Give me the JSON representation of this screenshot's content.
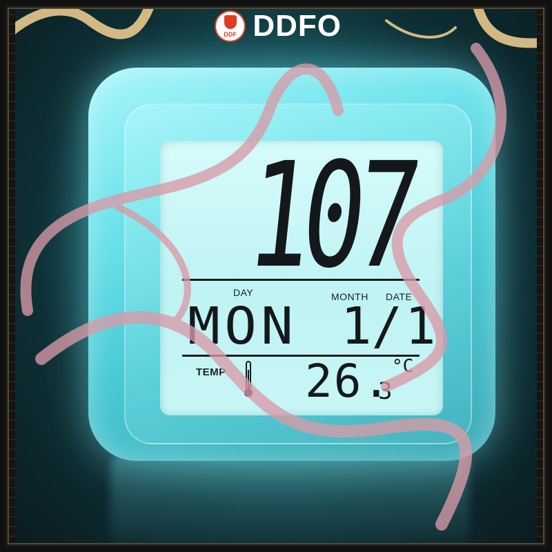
{
  "brand": {
    "name": "DDFO",
    "badge_text": "DDF"
  },
  "clock": {
    "time": "10:07",
    "time_display": "107",
    "day_label": "DAY",
    "month_label": "MONTH",
    "date_label": "DATE",
    "day_name": "MON",
    "month": "1/",
    "date": "1",
    "temp_label": "TEMP",
    "temperature_int": "26.",
    "temperature_dec": "3",
    "temperature_unit": "°C"
  },
  "colors": {
    "cube_glow": "#6fe3ec",
    "lcd_background": "#c8f6f6",
    "lcd_segments": "#15181a",
    "ribbon_pink": "#d99aa6",
    "ribbon_gold": "#e8c98e",
    "logo_accent": "#e23b22"
  },
  "icons": [
    "thermometer-icon",
    "brand-badge-icon"
  ]
}
